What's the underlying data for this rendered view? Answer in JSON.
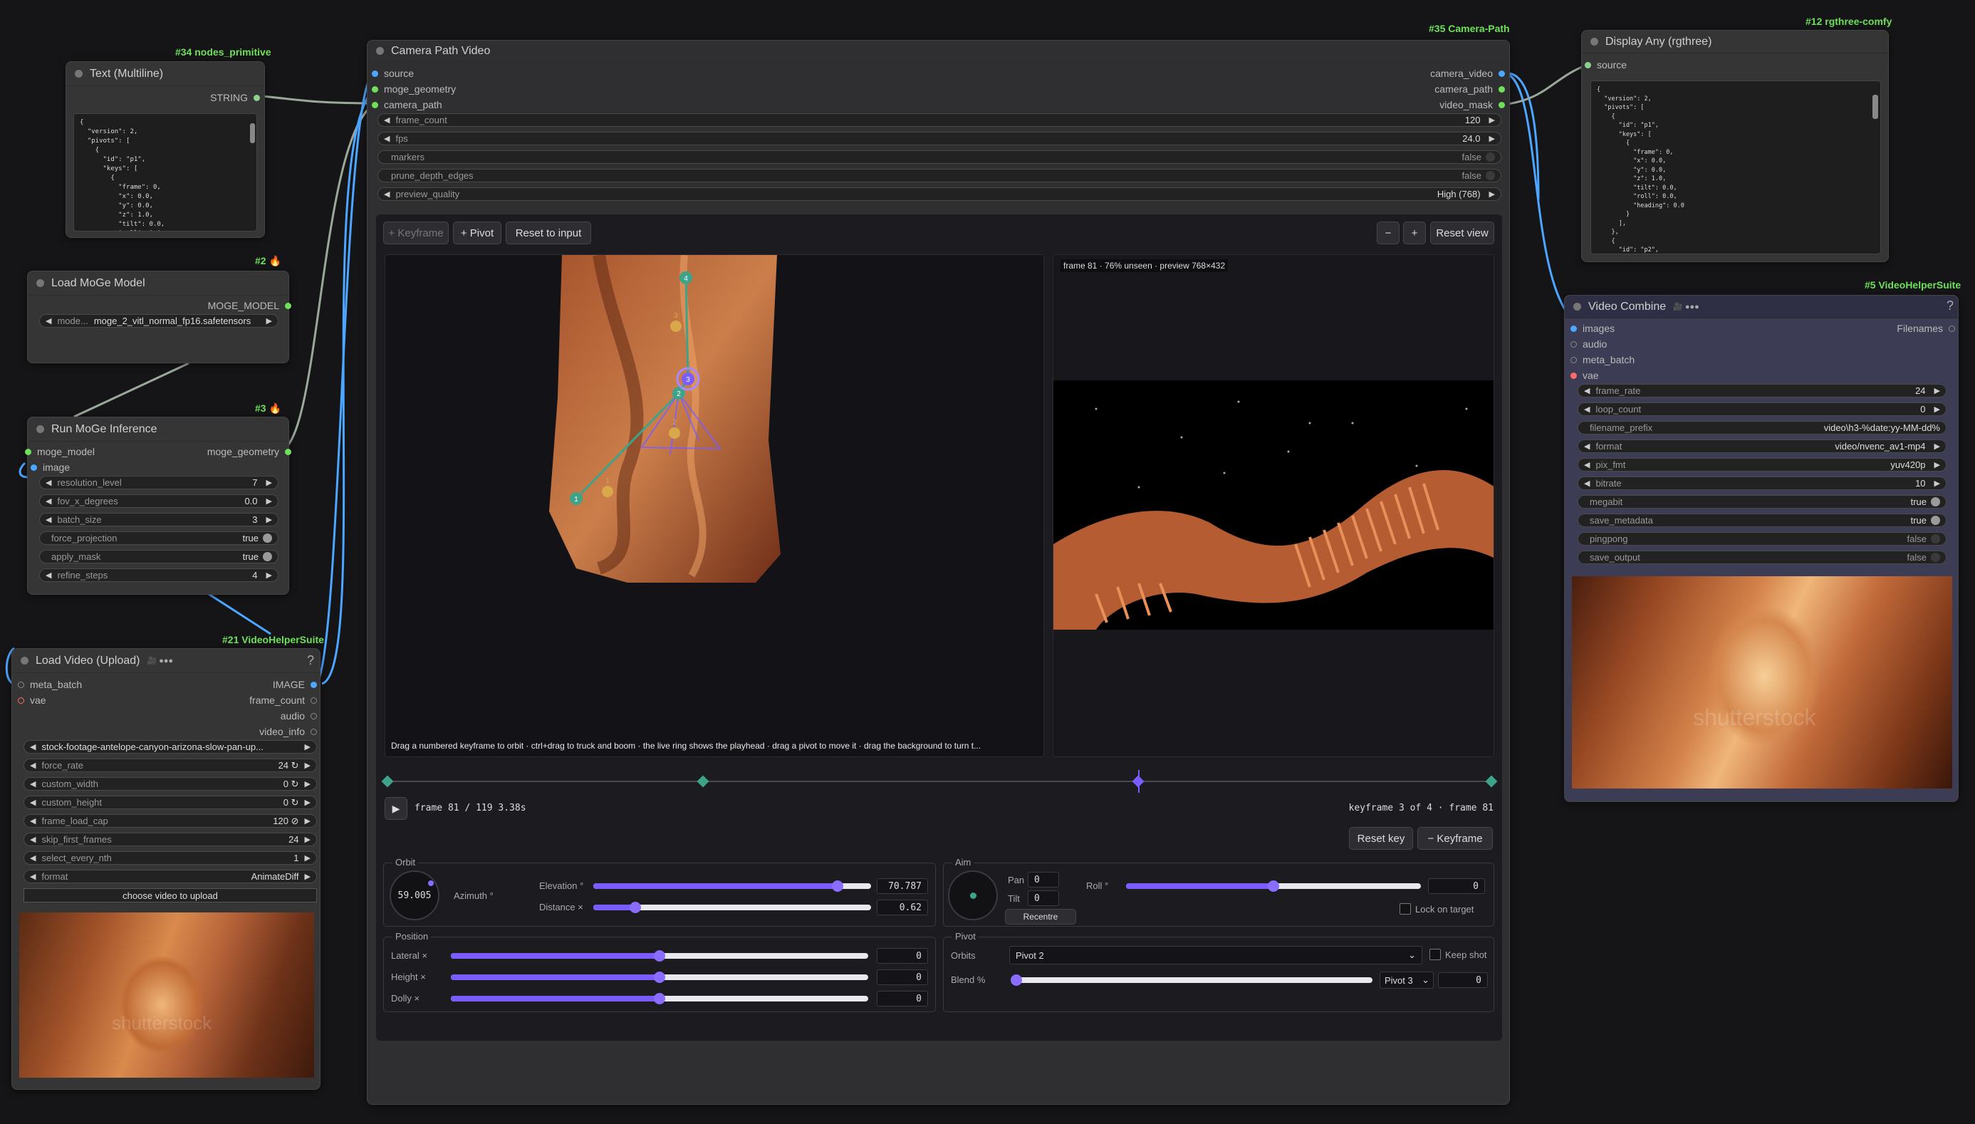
{
  "tags": {
    "text_node": "#34 nodes_primitive",
    "load_moge": "#2",
    "run_moge": "#3",
    "load_video": "#21 VideoHelperSuite",
    "camera_path": "#35 Camera-Path",
    "display_any": "#12 rgthree-comfy",
    "video_combine": "#5 VideoHelperSuite",
    "fire": "🔥"
  },
  "text_node": {
    "title": "Text (Multiline)",
    "output": "STRING",
    "content": "{\n  \"version\": 2,\n  \"pivots\": [\n    {\n      \"id\": \"p1\",\n      \"keys\": [\n        {\n          \"frame\": 0,\n          \"x\": 0.0,\n          \"y\": 0.0,\n          \"z\": 1.0,\n          \"tilt\": 0.0,\n          \"roll\": 0.0,"
  },
  "load_moge": {
    "title": "Load MoGe Model",
    "output": "MOGE_MODEL",
    "model_label": "mode...",
    "model_value": "moge_2_vitl_normal_fp16.safetensors"
  },
  "run_moge": {
    "title": "Run MoGe Inference",
    "in_model": "moge_model",
    "out_geometry": "moge_geometry",
    "in_image": "image",
    "widgets": [
      {
        "label": "resolution_level",
        "value": "7"
      },
      {
        "label": "fov_x_degrees",
        "value": "0.0"
      },
      {
        "label": "batch_size",
        "value": "3"
      },
      {
        "label": "force_projection",
        "value": "true"
      },
      {
        "label": "apply_mask",
        "value": "true"
      },
      {
        "label": "refine_steps",
        "value": "4"
      }
    ]
  },
  "load_video": {
    "title": "Load Video (Upload)",
    "badge": "🎥 ●●●",
    "help": "?",
    "inputs": [
      "meta_batch",
      "vae"
    ],
    "outputs": [
      "IMAGE",
      "frame_count",
      "audio",
      "video_info"
    ],
    "file": "stock-footage-antelope-canyon-arizona-slow-pan-up...",
    "widgets": [
      {
        "label": "force_rate",
        "value": "24 ↻"
      },
      {
        "label": "custom_width",
        "value": "0 ↻"
      },
      {
        "label": "custom_height",
        "value": "0 ↻"
      },
      {
        "label": "frame_load_cap",
        "value": "120 ⊘"
      },
      {
        "label": "skip_first_frames",
        "value": "24"
      },
      {
        "label": "select_every_nth",
        "value": "1"
      },
      {
        "label": "format",
        "value": "AnimateDiff"
      }
    ],
    "upload_label": "choose video to upload",
    "watermark": "shutterstock"
  },
  "camera": {
    "title": "Camera Path Video",
    "inputs": [
      "source",
      "moge_geometry",
      "camera_path"
    ],
    "outputs": [
      "camera_video",
      "camera_path",
      "video_mask"
    ],
    "widgets": [
      {
        "label": "frame_count",
        "value": "120"
      },
      {
        "label": "fps",
        "value": "24.0"
      },
      {
        "label": "markers",
        "value": "false"
      },
      {
        "label": "prune_depth_edges",
        "value": "false"
      },
      {
        "label": "preview_quality",
        "value": "High (768)"
      }
    ],
    "toolbar": {
      "keyframe": "+ Keyframe",
      "pivot": "+ Pivot",
      "reset_input": "Reset to input",
      "zoom_out": "−",
      "zoom_in": "+",
      "reset_view": "Reset view"
    },
    "preview_label": "frame 81 · 76% unseen · preview 768×432",
    "hint": "Drag a numbered keyframe to orbit · ctrl+drag to truck and boom · the live ring shows the playhead · drag a pivot to move it · drag the background to turn t...",
    "frame_info": "frame 81 / 119  3.38s",
    "keyframe_info": "keyframe 3 of 4 · frame 81",
    "reset_key": "Reset key",
    "remove_key": "− Keyframe",
    "orbit": {
      "label": "Orbit",
      "azimuth_value": "59.005",
      "azimuth_label": "Azimuth °",
      "elevation_label": "Elevation °",
      "elevation_value": "70.787",
      "elevation_frac": 0.88,
      "distance_label": "Distance ×",
      "distance_value": "0.62",
      "distance_frac": 0.15
    },
    "aim": {
      "label": "Aim",
      "pan_label": "Pan",
      "pan_value": "0",
      "tilt_label": "Tilt",
      "tilt_value": "0",
      "recentre": "Recentre",
      "roll_label": "Roll °",
      "roll_value": "0",
      "roll_frac": 0.5,
      "lock_label": "Lock on target"
    },
    "position": {
      "label": "Position",
      "lateral_label": "Lateral ×",
      "lateral_value": "0",
      "height_label": "Height ×",
      "height_value": "0",
      "dolly_label": "Dolly ×",
      "dolly_value": "0",
      "frac": 0.5
    },
    "pivot": {
      "label": "Pivot",
      "orbits_label": "Orbits",
      "orbits_value": "Pivot 2",
      "keep_shot": "Keep shot",
      "blend_label": "Blend %",
      "blend_target": "Pivot 3",
      "blend_value": "0",
      "blend_frac": 0.0
    },
    "keyframe_numbers": [
      "1",
      "2",
      "3",
      "4"
    ],
    "pivot_numbers": [
      "1",
      "2",
      "3"
    ],
    "timeline_fracs": [
      0.0,
      0.286,
      0.68,
      1.0
    ],
    "playhead_frac": 0.68,
    "play": "▶"
  },
  "display_any": {
    "title": "Display Any (rgthree)",
    "input": "source",
    "content": "{\n  \"version\": 2,\n  \"pivots\": [\n    {\n      \"id\": \"p1\",\n      \"keys\": [\n        {\n          \"frame\": 0,\n          \"x\": 0.0,\n          \"y\": 0.0,\n          \"z\": 1.0,\n          \"tilt\": 0.0,\n          \"roll\": 0.0,\n          \"heading\": 0.0\n        }\n      ],\n    },\n    {\n      \"id\": \"p2\","
  },
  "video_combine": {
    "title": "Video Combine",
    "badge": "🎥 ●●●",
    "help": "?",
    "inputs": [
      "images",
      "audio",
      "meta_batch",
      "vae"
    ],
    "output": "Filenames",
    "widgets": [
      {
        "label": "frame_rate",
        "value": "24"
      },
      {
        "label": "loop_count",
        "value": "0"
      },
      {
        "label": "filename_prefix",
        "value": "video\\h3-%date:yy-MM-dd%"
      },
      {
        "label": "format",
        "value": "video/nvenc_av1-mp4"
      },
      {
        "label": "pix_fmt",
        "value": "yuv420p"
      },
      {
        "label": "bitrate",
        "value": "10"
      },
      {
        "label": "megabit",
        "value": "true"
      },
      {
        "label": "save_metadata",
        "value": "true"
      },
      {
        "label": "pingpong",
        "value": "false"
      },
      {
        "label": "save_output",
        "value": "false"
      }
    ],
    "watermark": "shutterstock"
  },
  "colors": {
    "canvas": "#151517",
    "node": "#353535",
    "accent": "#7b5cff",
    "keyframe": "#3fa38a",
    "pivot": "#d8a84a",
    "wire_blue": "#4da6ff",
    "wire_gray": "#9aa89a"
  }
}
